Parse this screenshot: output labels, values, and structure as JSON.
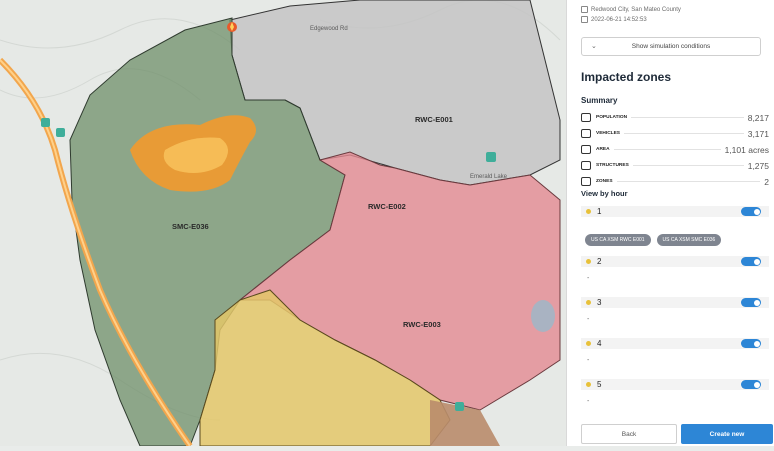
{
  "location": {
    "place": "Redwood City, San Mateo County",
    "datetime": "2022-06-21 14:52:53"
  },
  "simulation_button": {
    "label": "Show simulation conditions"
  },
  "impacted_zones": {
    "title": "Impacted zones",
    "summary_title": "Summary",
    "stats": [
      {
        "label": "POPULATION",
        "value": "8,217",
        "icon": "people-icon"
      },
      {
        "label": "VEHICLES",
        "value": "3,171",
        "icon": "car-icon"
      },
      {
        "label": "AREA",
        "value": "1,101 acres",
        "icon": "area-icon"
      },
      {
        "label": "STRUCTURES",
        "value": "1,275",
        "icon": "building-icon"
      },
      {
        "label": "ZONES",
        "value": "2",
        "icon": "zones-icon"
      }
    ]
  },
  "view_by_hour": {
    "title": "View by hour",
    "hours": [
      {
        "number": "1",
        "detail": "",
        "enabled": true,
        "chips": [
          "US CA XSM RWC E001",
          "US CA XSM SMC E036"
        ]
      },
      {
        "number": "2",
        "detail": "-",
        "enabled": true
      },
      {
        "number": "3",
        "detail": "-",
        "enabled": true
      },
      {
        "number": "4",
        "detail": "-",
        "enabled": true
      },
      {
        "number": "5",
        "detail": "-",
        "enabled": true
      }
    ]
  },
  "footer": {
    "back_label": "Back",
    "create_label": "Create new"
  },
  "map": {
    "zones": [
      "RWC-E001",
      "RWC-E002",
      "RWC-E003",
      "SMC-E036"
    ],
    "poi": "Emerald Lake",
    "street": "Edgewood Rd",
    "colors": {
      "zone_green": "#6f8f6a",
      "zone_pink": "#e38a92",
      "zone_yellow": "#e3c768",
      "zone_grey": "#bdbdbd",
      "fire_orange": "#f29a2e",
      "accent_blue": "#2d86d6"
    }
  }
}
